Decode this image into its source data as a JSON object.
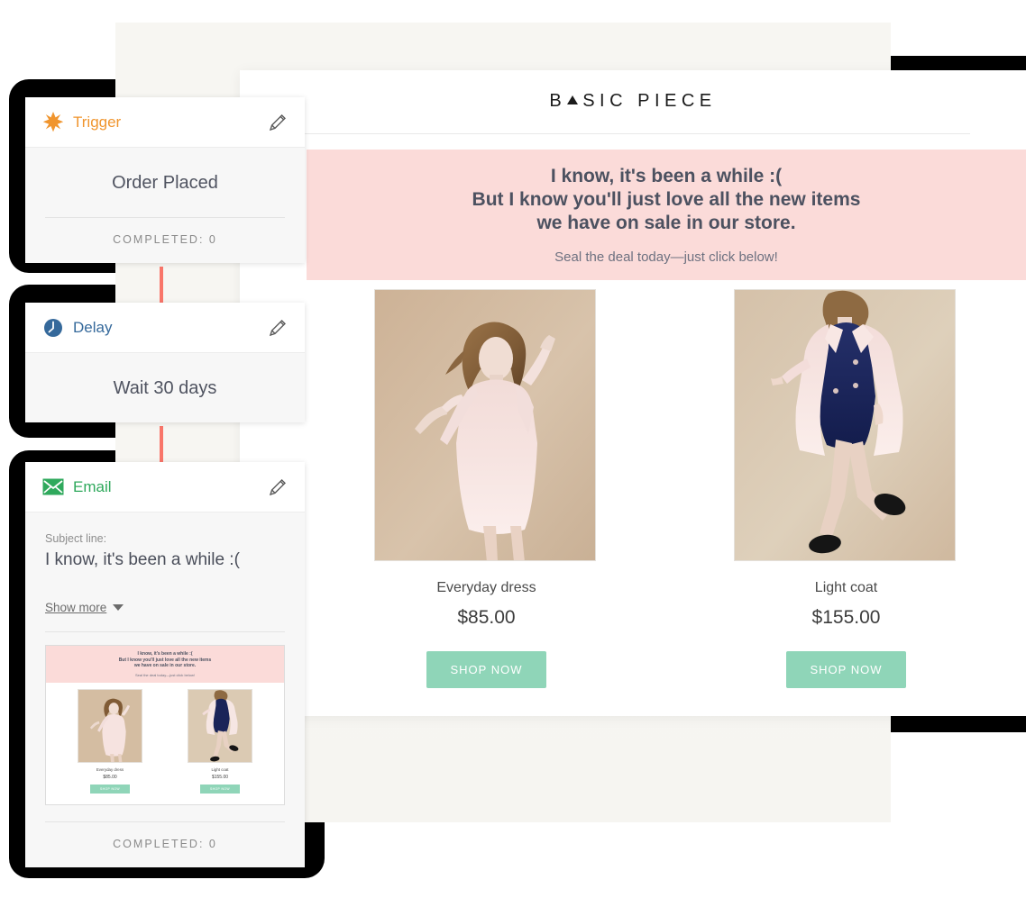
{
  "flow": {
    "cards": [
      {
        "type": "trigger",
        "icon": "starburst-icon",
        "title": "Trigger",
        "edit_icon": "pencil-icon",
        "main": "Order Placed",
        "completed": "COMPLETED: 0",
        "accent": "#f0952e"
      },
      {
        "type": "delay",
        "icon": "clock-icon",
        "title": "Delay",
        "edit_icon": "pencil-icon",
        "main": "Wait 30 days",
        "accent": "#35699b"
      },
      {
        "type": "email",
        "icon": "envelope-icon",
        "title": "Email",
        "edit_icon": "pencil-icon",
        "subject_label": "Subject line:",
        "subject_value": "I know, it's been a while :(",
        "show_more": "Show more",
        "completed": "COMPLETED: 0",
        "accent": "#2fa95c"
      }
    ],
    "connector_color": "#f9766a"
  },
  "email_preview": {
    "logo": {
      "before": "B",
      "glyph": "triangle-a",
      "after": "SIC PIECE"
    },
    "banner": {
      "headline_lines": [
        "I know, it's been a while :(",
        "But I know you'll just love all the new items",
        "we have on sale in our store."
      ],
      "subline": "Seal the deal today—just click below!",
      "background": "#fbdbd9"
    },
    "products": [
      {
        "image": "woman-in-pink-dress-photo",
        "name": "Everyday dress",
        "price": "$85.00",
        "cta": "SHOP NOW"
      },
      {
        "image": "woman-in-pink-coat-navy-dress-photo",
        "name": "Light coat",
        "price": "$155.00",
        "cta": "SHOP NOW"
      }
    ],
    "cta_color": "#8fd5b8"
  }
}
